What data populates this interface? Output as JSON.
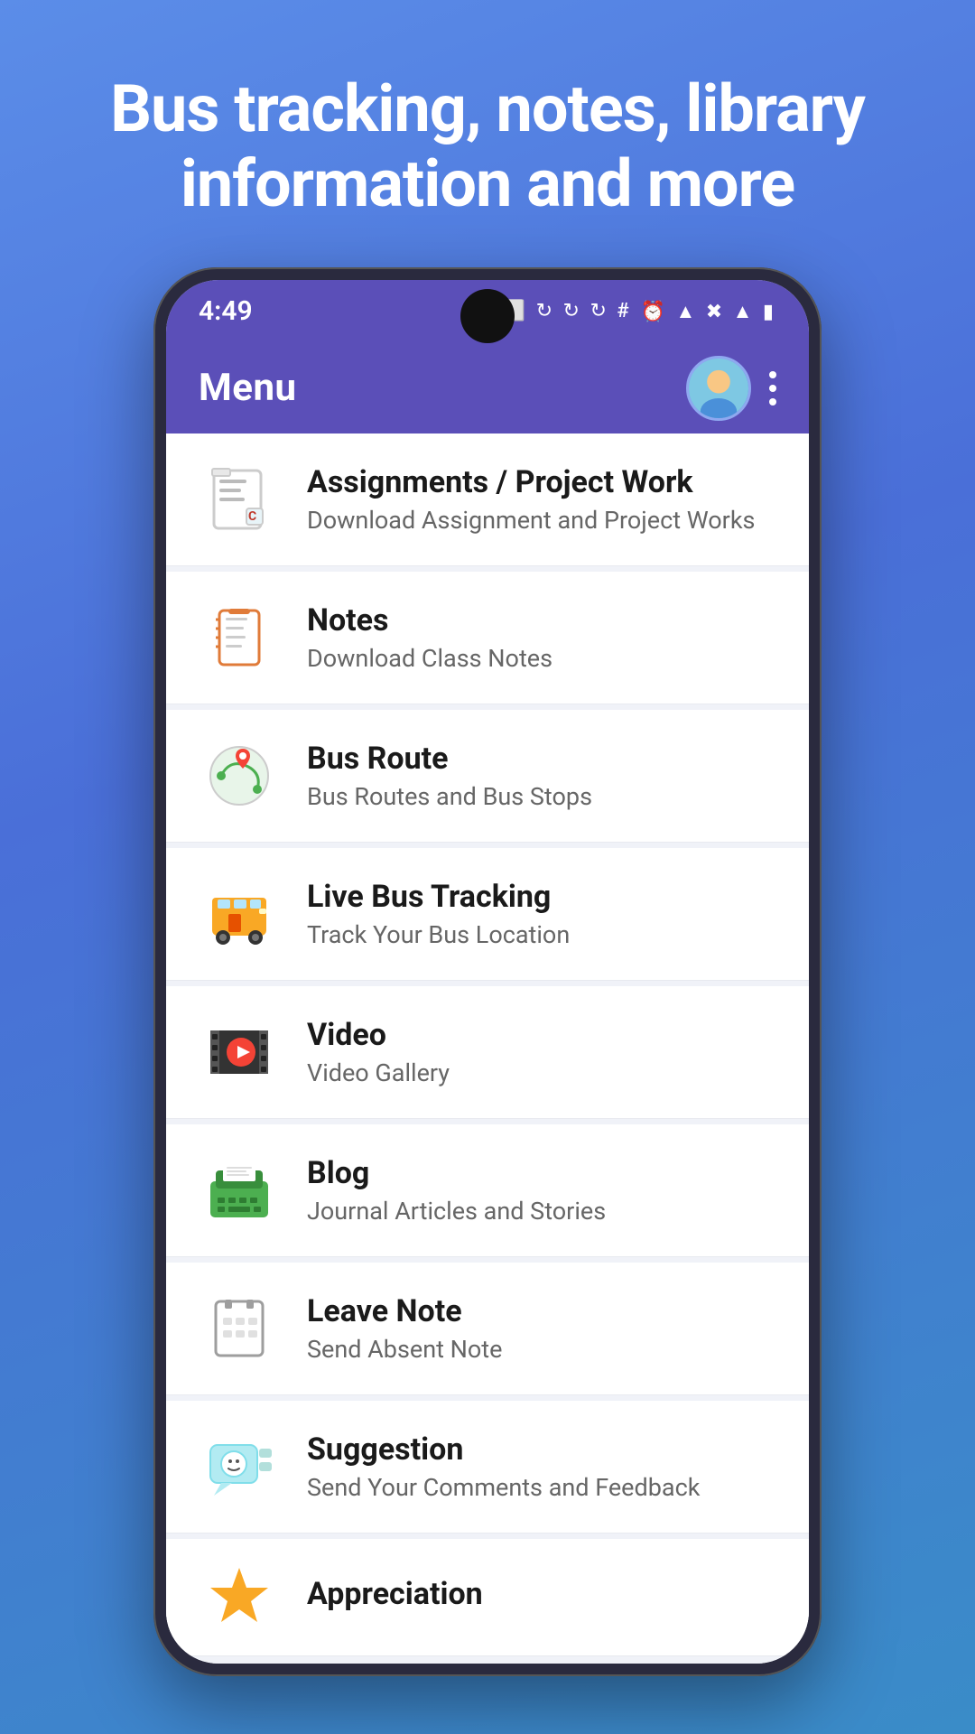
{
  "hero": {
    "text": "Bus tracking, notes, library information and more"
  },
  "statusBar": {
    "time": "4:49",
    "icons": "⏰ ▲ ✕ ▲ 🔋"
  },
  "appBar": {
    "title": "Menu",
    "avatarAlt": "User avatar",
    "moreOptions": "More options"
  },
  "menuItems": [
    {
      "id": "assignments",
      "title": "Assignments / Project Work",
      "subtitle": "Download Assignment and Project Works",
      "iconName": "assignments-icon"
    },
    {
      "id": "notes",
      "title": "Notes",
      "subtitle": "Download Class Notes",
      "iconName": "notes-icon"
    },
    {
      "id": "bus-route",
      "title": "Bus Route",
      "subtitle": "Bus Routes and Bus Stops",
      "iconName": "bus-route-icon"
    },
    {
      "id": "live-bus-tracking",
      "title": "Live Bus Tracking",
      "subtitle": "Track Your Bus Location",
      "iconName": "live-bus-tracking-icon"
    },
    {
      "id": "video",
      "title": "Video",
      "subtitle": "Video Gallery",
      "iconName": "video-icon"
    },
    {
      "id": "blog",
      "title": "Blog",
      "subtitle": "Journal Articles and Stories",
      "iconName": "blog-icon"
    },
    {
      "id": "leave-note",
      "title": "Leave Note",
      "subtitle": "Send Absent Note",
      "iconName": "leave-note-icon"
    },
    {
      "id": "suggestion",
      "title": "Suggestion",
      "subtitle": "Send Your Comments and Feedback",
      "iconName": "suggestion-icon"
    },
    {
      "id": "appreciation",
      "title": "Appreciation",
      "subtitle": "",
      "iconName": "appreciation-icon"
    }
  ]
}
